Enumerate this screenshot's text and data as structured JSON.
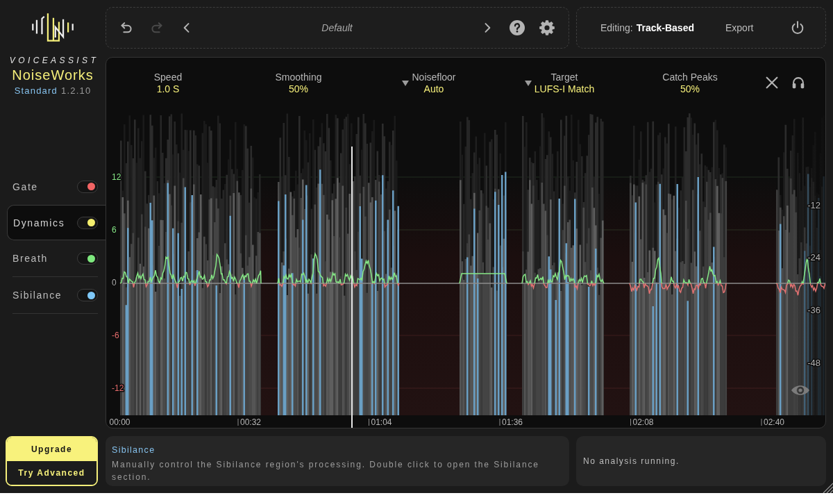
{
  "logo": {
    "brand": "VOICEASSIST",
    "product": "NoiseWorks",
    "edition": "Standard",
    "version": "1.2.10"
  },
  "modules": [
    {
      "label": "Gate",
      "selected": false,
      "on": true,
      "color": "#f26464"
    },
    {
      "label": "Dynamics",
      "selected": true,
      "on": true,
      "color": "#f5ef6e"
    },
    {
      "label": "Breath",
      "selected": false,
      "on": true,
      "color": "#7ee87e"
    },
    {
      "label": "Sibilance",
      "selected": false,
      "on": true,
      "color": "#7ec8f8"
    }
  ],
  "upgrade": {
    "title": "Upgrade",
    "action": "Try Advanced"
  },
  "preset_bar": {
    "history": [
      {
        "kind": "undo",
        "disabled": false
      },
      {
        "kind": "redo",
        "disabled": true
      }
    ],
    "preset": "Default"
  },
  "mode_bar": {
    "editing_label": "Editing:",
    "editing_value": "Track-Based",
    "export": "Export"
  },
  "parameters": [
    {
      "label": "Speed",
      "value": "1.0 S",
      "dropdown": false
    },
    {
      "label": "Smoothing",
      "value": "50%",
      "dropdown": false
    },
    {
      "label": "Noisefloor",
      "value": "Auto",
      "dropdown": true
    },
    {
      "label": "Target",
      "value": "LUFS-I Match",
      "dropdown": true
    },
    {
      "label": "Catch Peaks",
      "value": "50%",
      "dropdown": false
    }
  ],
  "waveform": {
    "gain_ticks": [
      {
        "label": "12",
        "color": "#86e886"
      },
      {
        "label": "6",
        "color": "#86e886"
      },
      {
        "label": "0",
        "color": "#a8a8a8"
      },
      {
        "label": "-6",
        "color": "#e36a6a"
      },
      {
        "label": "-12",
        "color": "#e36a6a"
      }
    ],
    "level_ticks": [
      "-12",
      "-24",
      "-36",
      "-48"
    ],
    "time_ticks": [
      "00:00",
      "00:32",
      "01:04",
      "01:36",
      "02:08",
      "02:40"
    ]
  },
  "info_panel": {
    "title": "Sibilance",
    "text": "Manually control the Sibilance region's processing. Double click to open the Sibilance section."
  },
  "status_panel": {
    "text": "No analysis running."
  }
}
